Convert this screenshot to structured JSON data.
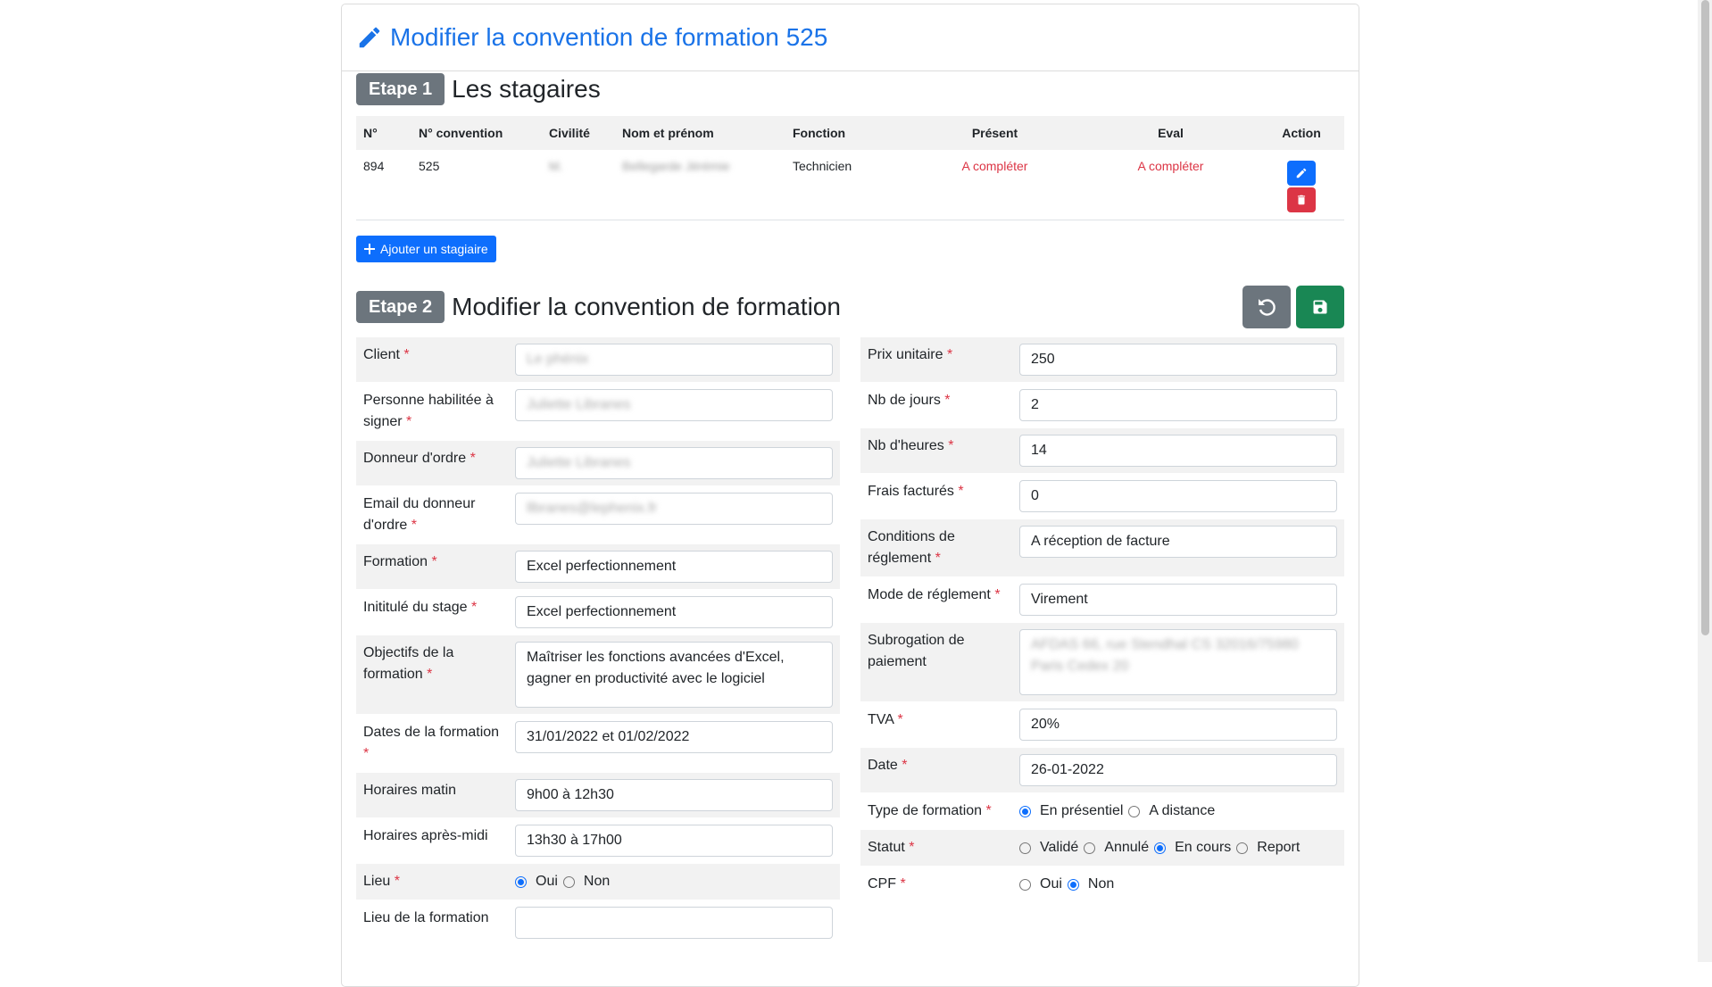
{
  "header": {
    "title": "Modifier la convention de formation 525"
  },
  "step1": {
    "badge": "Etape 1",
    "title": "Les stagaires",
    "columns": [
      "N°",
      "N° convention",
      "Civilité",
      "Nom et prénom",
      "Fonction",
      "Présent",
      "Eval",
      "Action"
    ],
    "rows": [
      {
        "num": "894",
        "convention": "525",
        "civilite": "M.",
        "nom": "Bellegarde Jérémie",
        "fonction": "Technicien",
        "present": "A compléter",
        "eval": "A compléter"
      }
    ],
    "add_label": "Ajouter un stagiaire"
  },
  "step2": {
    "badge": "Etape 2",
    "title": "Modifier la convention de formation",
    "left": {
      "client": {
        "label": "Client",
        "value": "Le phénix"
      },
      "personne": {
        "label": "Personne habilitée à signer",
        "value": "Juliette Libranes"
      },
      "donneur": {
        "label": "Donneur d'ordre",
        "value": "Juliette Libranes"
      },
      "email": {
        "label": "Email du donneur d'ordre",
        "value": "llbranes@lephenix.fr"
      },
      "formation": {
        "label": "Formation",
        "value": "Excel perfectionnement"
      },
      "intitule": {
        "label": "Inititulé du stage",
        "value": "Excel perfectionnement"
      },
      "objectifs": {
        "label": "Objectifs de la formation",
        "value": "Maîtriser les fonctions avancées d'Excel, gagner en productivité avec le logiciel"
      },
      "dates": {
        "label": "Dates de la formation",
        "value": "31/01/2022 et 01/02/2022"
      },
      "matin": {
        "label": "Horaires matin",
        "value": "9h00 à 12h30"
      },
      "apresmidi": {
        "label": "Horaires après-midi",
        "value": "13h30 à 17h00"
      },
      "lieu": {
        "label": "Lieu",
        "opt_oui": "Oui",
        "opt_non": "Non"
      },
      "lieu_formation": {
        "label": "Lieu de la formation"
      }
    },
    "right": {
      "prix": {
        "label": "Prix unitaire",
        "value": "250"
      },
      "jours": {
        "label": "Nb de jours",
        "value": "2"
      },
      "heures": {
        "label": "Nb d'heures",
        "value": "14"
      },
      "frais": {
        "label": "Frais facturés",
        "value": "0"
      },
      "conditions": {
        "label": "Conditions de réglement",
        "value": "A réception de facture"
      },
      "mode": {
        "label": "Mode de réglement",
        "value": "Virement"
      },
      "subrogation": {
        "label": "Subrogation de paiement",
        "value": "AFDAS 66, rue Stendhal CS 32016/75980 Paris Cedex 20"
      },
      "tva": {
        "label": "TVA",
        "value": "20%"
      },
      "date": {
        "label": "Date",
        "value": "26-01-2022"
      },
      "type": {
        "label": "Type de formation",
        "opt1": "En présentiel",
        "opt2": "A distance"
      },
      "statut": {
        "label": "Statut",
        "opt1": "Validé",
        "opt2": "Annulé",
        "opt3": "En cours",
        "opt4": "Report"
      },
      "cpf": {
        "label": "CPF",
        "opt_oui": "Oui",
        "opt_non": "Non"
      }
    }
  },
  "required_mark": "*",
  "colors": {
    "primary": "#0d6efd",
    "danger": "#dc3545",
    "success": "#198754",
    "secondary": "#6c757d",
    "title": "#1a73e8"
  }
}
